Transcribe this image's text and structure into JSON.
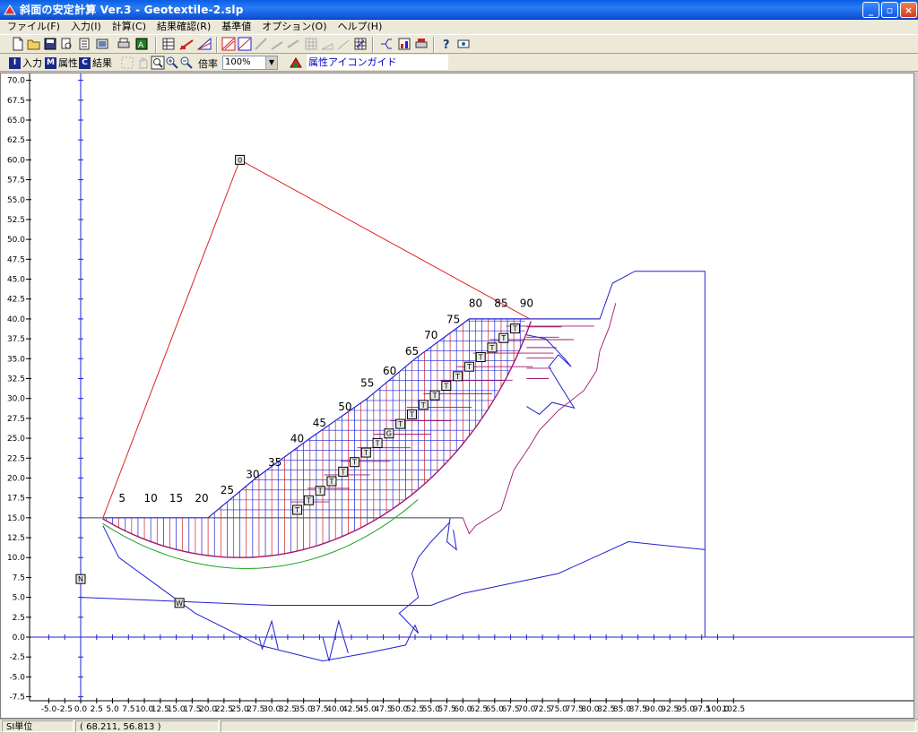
{
  "window": {
    "title": "斜面の安定計算 Ver.3 - Geotextile-2.slp",
    "buttons": {
      "minimize": "_",
      "maximize": "▫",
      "close": "×"
    }
  },
  "menu": [
    {
      "label": "ファイル(F)"
    },
    {
      "label": "入力(I)"
    },
    {
      "label": "計算(C)"
    },
    {
      "label": "結果確認(R)"
    },
    {
      "label": "基準値"
    },
    {
      "label": "オプション(O)"
    },
    {
      "label": "ヘルプ(H)"
    }
  ],
  "toolbar2": {
    "mode_input": {
      "key": "I",
      "label": "入力"
    },
    "mode_attr": {
      "key": "M",
      "label": "属性"
    },
    "mode_result": {
      "key": "C",
      "label": "結果"
    },
    "zoom_label": "倍率",
    "zoom_value": "100%",
    "guide_label": "属性アイコンガイド"
  },
  "axes": {
    "y_ticks": [
      "70.0",
      "67.5",
      "65.0",
      "62.5",
      "60.0",
      "57.5",
      "55.0",
      "52.5",
      "50.0",
      "47.5",
      "45.0",
      "42.5",
      "40.0",
      "37.5",
      "35.0",
      "32.5",
      "30.0",
      "27.5",
      "25.0",
      "22.5",
      "20.0",
      "17.5",
      "15.0",
      "12.5",
      "10.0",
      "7.5",
      "5.0",
      "2.5",
      "0.0",
      "-2.5",
      "-5.0",
      "-7.5"
    ],
    "x_ticks": [
      "-5.0",
      "-2.5",
      "0.0",
      "2.5",
      "5.0",
      "7.5",
      "10.0",
      "12.5",
      "15.0",
      "17.5",
      "20.0",
      "22.5",
      "25.0",
      "27.5",
      "30.0",
      "32.5",
      "35.0",
      "37.5",
      "40.0",
      "42.5",
      "45.0",
      "47.5",
      "50.0",
      "52.5",
      "55.0",
      "57.5",
      "60.0",
      "62.5",
      "65.0",
      "67.5",
      "70.0",
      "72.5",
      "75.0",
      "77.5",
      "80.0",
      "82.5",
      "85.0",
      "87.5",
      "90.0",
      "92.5",
      "95.0",
      "97.5",
      "100.0",
      "102.5"
    ]
  },
  "slice_numbers": [
    "5",
    "10",
    "15",
    "20",
    "25",
    "30",
    "35",
    "40",
    "45",
    "50",
    "55",
    "60",
    "65",
    "70",
    "75",
    "80",
    "85",
    "90"
  ],
  "markers": {
    "center": "0",
    "water": "W",
    "north": "N",
    "geotextile": "T",
    "geotextile_alt": "G"
  },
  "colors": {
    "slope_blue": "#2020d0",
    "slice_red": "#d02020",
    "circle_red": "#e02020",
    "bottom_green": "#20a020",
    "geo_purple": "#a01870",
    "ground": "#404040"
  },
  "status": {
    "units": "SI単位",
    "coords": "(   68.211,   56.813 )"
  }
}
